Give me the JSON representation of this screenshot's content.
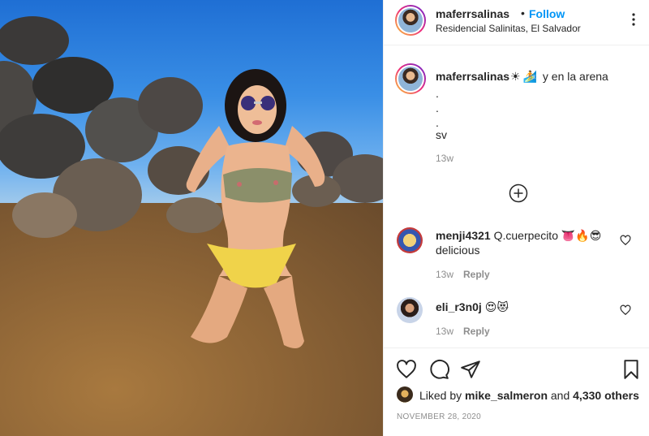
{
  "header": {
    "username": "maferrsalinas",
    "separator": "•",
    "follow_label": "Follow",
    "location": "Residencial Salinitas, El Salvador",
    "more_icon": "more-horizontal-icon"
  },
  "caption": {
    "username": "maferrsalinas",
    "emoji_1": "☀",
    "emoji_2": "🏄",
    "text": "y en la arena",
    "lines": [
      ".",
      ".",
      ".",
      "sv"
    ],
    "time": "13w"
  },
  "load_more_icon": "plus-circle-icon",
  "comments": [
    {
      "username": "menji4321",
      "text": "Q.cuerpecito 👅🔥😎 delicious",
      "time": "13w",
      "reply_label": "Reply"
    },
    {
      "username": "eli_r3n0j",
      "text": "😍😻",
      "time": "13w",
      "reply_label": "Reply"
    }
  ],
  "actions": {
    "like_icon": "heart-icon",
    "comment_icon": "comment-icon",
    "share_icon": "send-icon",
    "save_icon": "bookmark-icon"
  },
  "likes": {
    "prefix": "Liked by",
    "user": "mike_salmeron",
    "and_label": "and",
    "others": "4,330 others"
  },
  "date": "NOVEMBER 28, 2020"
}
